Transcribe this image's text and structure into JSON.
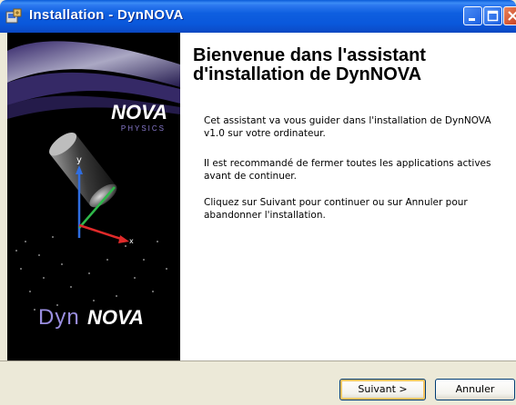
{
  "window": {
    "title": "Installation - DynNOVA",
    "icon": "installer-icon",
    "controls": [
      "minimize-icon",
      "maximize-icon",
      "close-icon"
    ]
  },
  "banner": {
    "logo_top": "NOVA",
    "logo_sub": "PHYSICS",
    "axis_y": "y",
    "axis_x": "x",
    "logo_bottom_prefix": "Dyn",
    "logo_bottom_suffix": "NOVA"
  },
  "content": {
    "title": "Bienvenue dans l'assistant d'installation de DynNOVA",
    "paragraphs": [
      "Cet assistant va vous guider dans l'installation de DynNOVA v1.0 sur votre ordinateur.",
      "Il est recommandé de fermer toutes les applications actives avant de continuer.",
      "Cliquez sur Suivant pour continuer ou sur Annuler pour abandonner l'installation."
    ]
  },
  "buttons": {
    "next": "Suivant >",
    "cancel": "Annuler"
  },
  "colors": {
    "titlebar": "#0a58db",
    "face": "#ece9d8",
    "accent_orange": "#f6c563"
  }
}
